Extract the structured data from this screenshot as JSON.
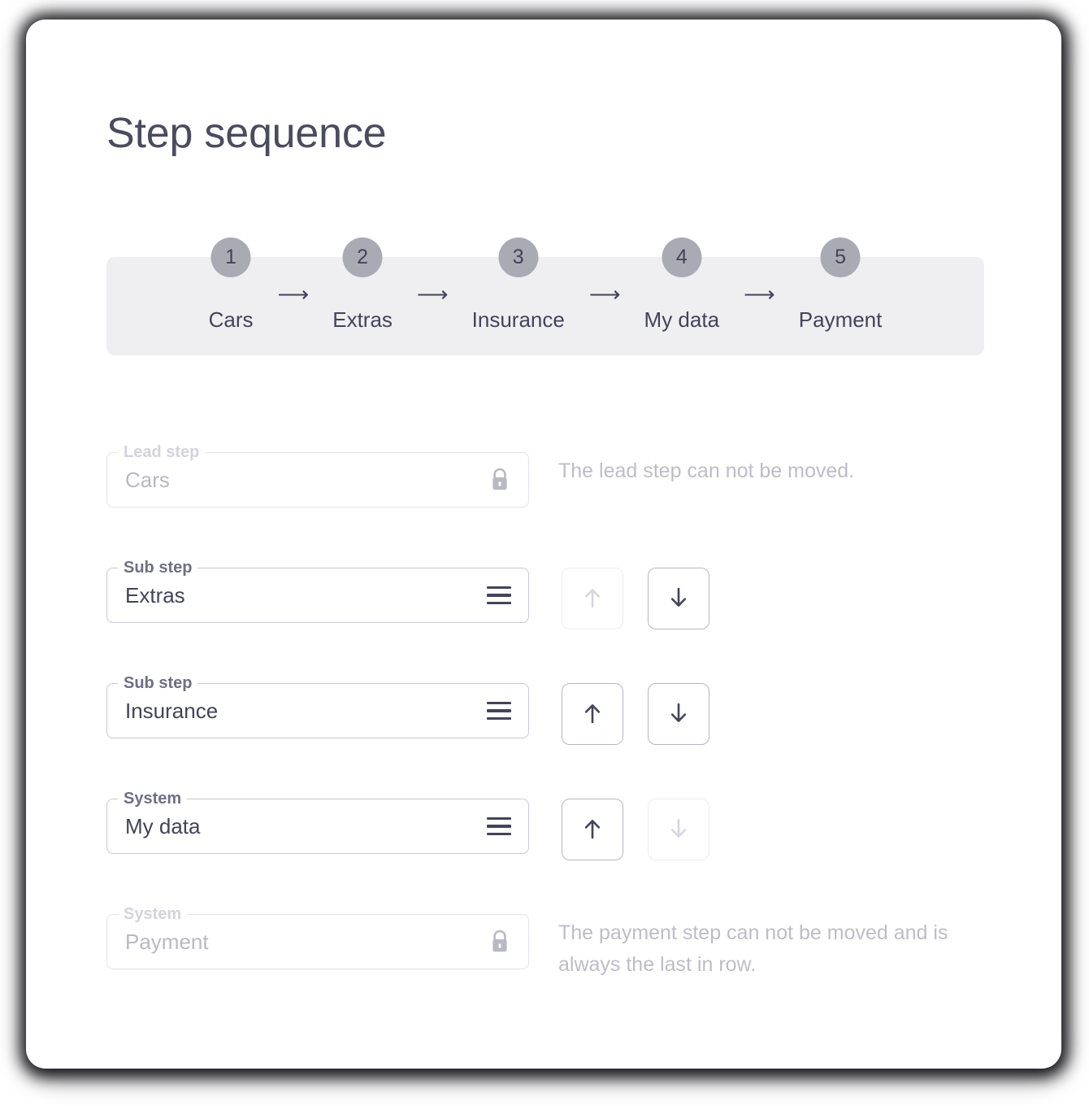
{
  "page": {
    "title": "Step sequence",
    "accent_color": "#43435a",
    "band_color": "#efeff2",
    "badge_color": "#aaaab4",
    "muted_color": "#bdbdc8"
  },
  "stepper": {
    "arrow_glyph": "⟶",
    "steps": [
      {
        "number": "1",
        "label": "Cars"
      },
      {
        "number": "2",
        "label": "Extras"
      },
      {
        "number": "3",
        "label": "Insurance"
      },
      {
        "number": "4",
        "label": "My data"
      },
      {
        "number": "5",
        "label": "Payment"
      }
    ]
  },
  "rows": [
    {
      "label": "Lead step",
      "value": "Cars",
      "icon": "lock-icon",
      "disabled": true,
      "helper": "The lead step can not be moved.",
      "move_up": null,
      "move_down": null
    },
    {
      "label": "Sub step",
      "value": "Extras",
      "icon": "drag-handle-icon",
      "disabled": false,
      "helper": null,
      "move_up": {
        "enabled": false
      },
      "move_down": {
        "enabled": true
      }
    },
    {
      "label": "Sub step",
      "value": "Insurance",
      "icon": "drag-handle-icon",
      "disabled": false,
      "helper": null,
      "move_up": {
        "enabled": true
      },
      "move_down": {
        "enabled": true
      }
    },
    {
      "label": "System",
      "value": "My data",
      "icon": "drag-handle-icon",
      "disabled": false,
      "helper": null,
      "move_up": {
        "enabled": true
      },
      "move_down": {
        "enabled": false
      }
    },
    {
      "label": "System",
      "value": "Payment",
      "icon": "lock-icon",
      "disabled": true,
      "helper": "The payment step can not be moved and is always the last in row.",
      "move_up": null,
      "move_down": null
    }
  ]
}
